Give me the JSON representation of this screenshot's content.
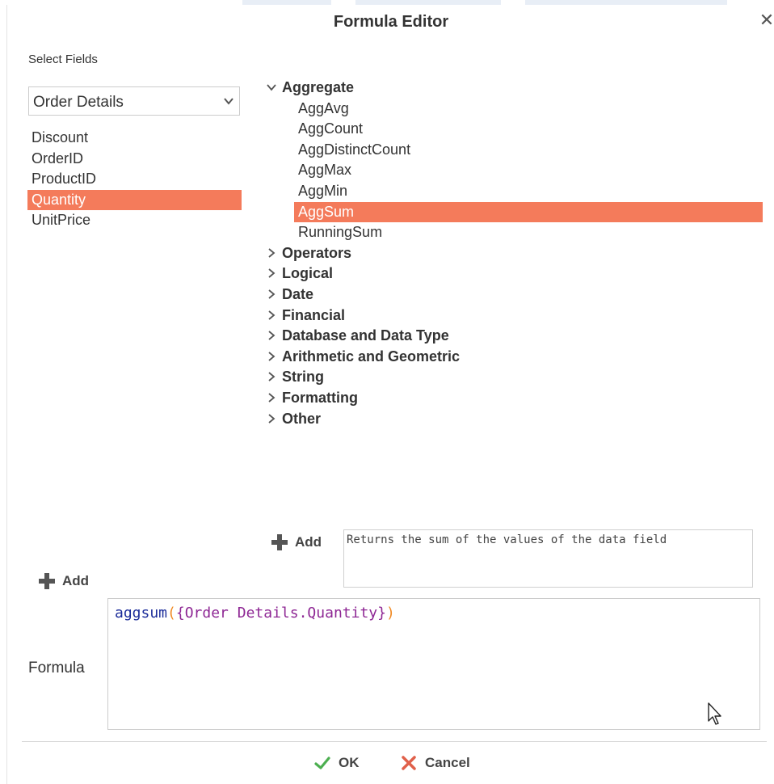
{
  "dialog": {
    "title": "Formula Editor",
    "close_icon": "close-icon"
  },
  "fields": {
    "label": "Select Fields",
    "selected_table": "Order Details",
    "items": [
      "Discount",
      "OrderID",
      "ProductID",
      "Quantity",
      "UnitPrice"
    ],
    "selected_item": "Quantity"
  },
  "functions": {
    "expanded": {
      "label": "Aggregate",
      "items": [
        "AggAvg",
        "AggCount",
        "AggDistinctCount",
        "AggMax",
        "AggMin",
        "AggSum",
        "RunningSum"
      ],
      "selected_item": "AggSum"
    },
    "collapsed": [
      "Operators",
      "Logical",
      "Date",
      "Financial",
      "Database and Data Type",
      "Arithmetic and Geometric",
      "String",
      "Formatting",
      "Other"
    ]
  },
  "add_function_label": "Add",
  "add_field_label": "Add",
  "description": "Returns the sum of the values of the data field",
  "formula": {
    "label": "Formula",
    "fn": "aggsum",
    "open_paren": "(",
    "field": "{Order Details.Quantity}",
    "close_paren": ")"
  },
  "footer": {
    "ok_label": "OK",
    "cancel_label": "Cancel"
  },
  "colors": {
    "selection": "#f47b5b",
    "ok_icon": "#4caf50",
    "cancel_icon": "#e0604a"
  }
}
